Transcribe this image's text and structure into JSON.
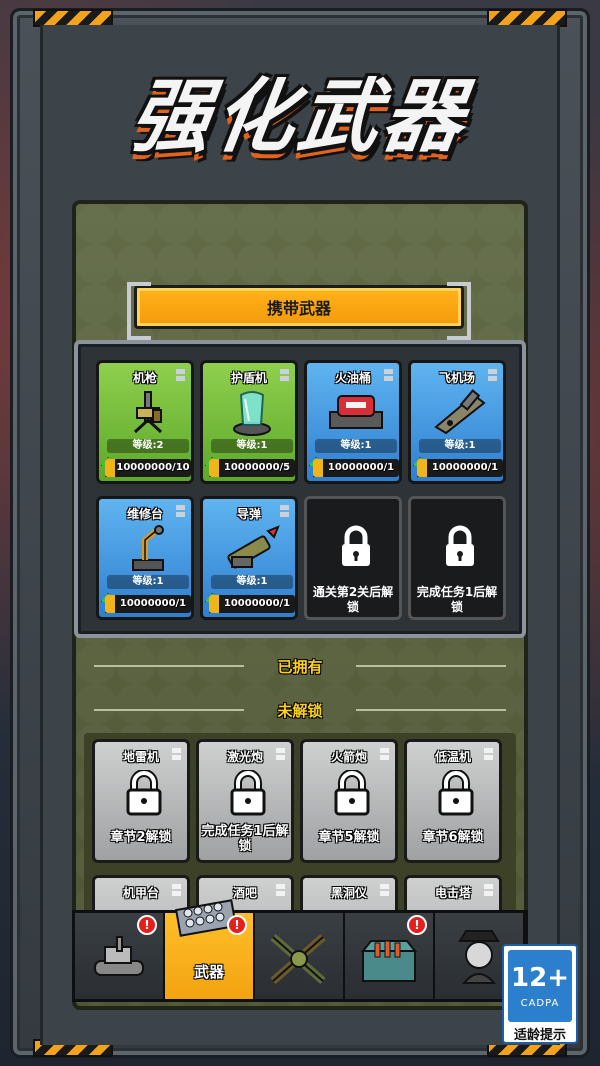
{
  "page_title": "强化武器",
  "carry_section_title": "携带武器",
  "carried_weapons": [
    {
      "name": "机枪",
      "level": "等级:2",
      "progress": "10000000/10",
      "rarity": "green",
      "progress_fraction": 0.0
    },
    {
      "name": "护盾机",
      "level": "等级:1",
      "progress": "10000000/5",
      "rarity": "green",
      "progress_fraction": 0.0
    },
    {
      "name": "火油桶",
      "level": "等级:1",
      "progress": "10000000/1",
      "rarity": "blue",
      "progress_fraction": 0.0
    },
    {
      "name": "飞机场",
      "level": "等级:1",
      "progress": "10000000/1",
      "rarity": "blue",
      "progress_fraction": 0.0
    },
    {
      "name": "维修台",
      "level": "等级:1",
      "progress": "10000000/1",
      "rarity": "blue",
      "progress_fraction": 0.0
    },
    {
      "name": "导弹",
      "level": "等级:1",
      "progress": "10000000/1",
      "rarity": "blue",
      "progress_fraction": 0.0
    }
  ],
  "locked_slots": [
    {
      "message": "通关第2关后解锁"
    },
    {
      "message": "完成任务1后解锁"
    }
  ],
  "owned_divider": "已拥有",
  "unlocked_divider": "未解锁",
  "locked_weapons": [
    {
      "name": "地雷机",
      "message": "章节2解锁"
    },
    {
      "name": "激光炮",
      "message": "完成任务1后解锁"
    },
    {
      "name": "火箭炮",
      "message": "章节5解锁"
    },
    {
      "name": "低温机",
      "message": "章节6解锁"
    },
    {
      "name": "机甲台",
      "message": ""
    },
    {
      "name": "酒吧",
      "message": ""
    },
    {
      "name": "黑洞仪",
      "message": ""
    },
    {
      "name": "电击塔",
      "message": ""
    }
  ],
  "tabs": [
    {
      "icon": "tank-icon",
      "label": "",
      "badge": "!",
      "active": false
    },
    {
      "icon": "rocket-launcher-icon",
      "label": "武器",
      "badge": "!",
      "active": true
    },
    {
      "icon": "crossed-rifles-icon",
      "label": "",
      "badge": "",
      "active": false
    },
    {
      "icon": "ammo-crate-icon",
      "label": "",
      "badge": "!",
      "active": false
    },
    {
      "icon": "officer-icon",
      "label": "",
      "badge": "",
      "active": false
    }
  ],
  "age_rating": {
    "number": "12+",
    "org": "CADPA",
    "hint": "适龄提示"
  },
  "colors": {
    "accent": "#f5a00f",
    "green_card": "#6fbc39",
    "blue_card": "#3d8fdc",
    "badge": "#e3201b"
  }
}
